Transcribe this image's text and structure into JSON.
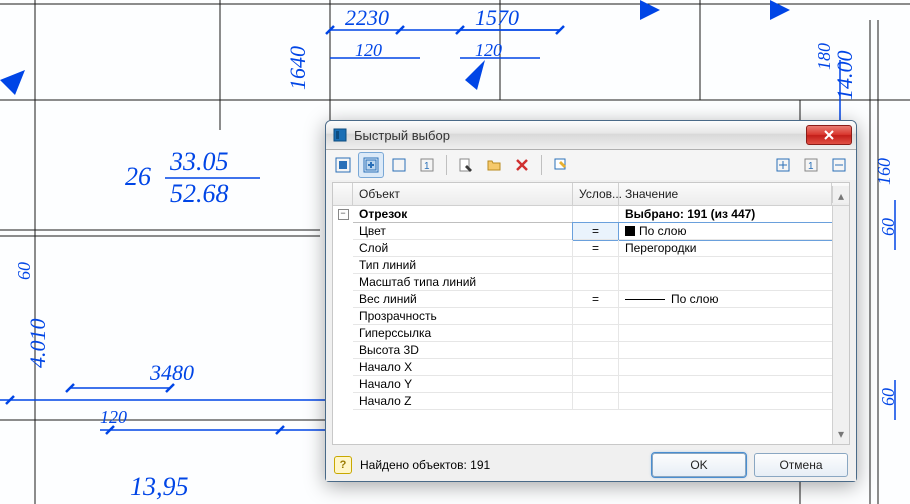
{
  "drawing": {
    "dims": {
      "d2230": "2230",
      "d1570": "1570",
      "d120a": "120",
      "d120b": "120",
      "d1640": "1640",
      "d180": "180",
      "d1400": "14.00",
      "d26": "26",
      "d3305": "33.05",
      "d5268": "52.68",
      "d160": "160",
      "d60a": "60",
      "d60b": "60",
      "d60c": "60",
      "d4010": "4.010",
      "d3480": "3480",
      "d120c": "120",
      "d1395": "13,95"
    }
  },
  "dialog": {
    "title": "Быстрый выбор",
    "columns": {
      "object": "Объект",
      "condition": "Услов...",
      "value": "Значение"
    },
    "group": {
      "label": "Отрезок",
      "summary": "Выбрано: 191 (из 447)"
    },
    "rows": {
      "color": {
        "label": "Цвет",
        "cond": "=",
        "value": "По слою"
      },
      "layer": {
        "label": "Слой",
        "cond": "=",
        "value": "Перегородки"
      },
      "ltype": {
        "label": "Тип линий",
        "cond": "",
        "value": ""
      },
      "lscale": {
        "label": "Масштаб типа линий",
        "cond": "",
        "value": ""
      },
      "lweight": {
        "label": "Вес линий",
        "cond": "=",
        "value": "По слою"
      },
      "transp": {
        "label": "Прозрачность",
        "cond": "",
        "value": ""
      },
      "hyper": {
        "label": "Гиперссылка",
        "cond": "",
        "value": ""
      },
      "h3d": {
        "label": "Высота 3D",
        "cond": "",
        "value": ""
      },
      "startx": {
        "label": "Начало X",
        "cond": "",
        "value": ""
      },
      "starty": {
        "label": "Начало Y",
        "cond": "",
        "value": ""
      },
      "startz": {
        "label": "Начало Z",
        "cond": "",
        "value": ""
      }
    },
    "status": "Найдено объектов: 191",
    "buttons": {
      "ok": "OK",
      "cancel": "Отмена"
    }
  },
  "chart_data": {
    "type": "table",
    "title": "Быстрый выбор — Отрезок (Выбрано: 191 из 447)",
    "columns": [
      "Объект",
      "Услов...",
      "Значение"
    ],
    "rows": [
      [
        "Цвет",
        "=",
        "По слою"
      ],
      [
        "Слой",
        "=",
        "Перегородки"
      ],
      [
        "Тип линий",
        "",
        ""
      ],
      [
        "Масштаб типа линий",
        "",
        ""
      ],
      [
        "Вес линий",
        "=",
        "По слою"
      ],
      [
        "Прозрачность",
        "",
        ""
      ],
      [
        "Гиперссылка",
        "",
        ""
      ],
      [
        "Высота 3D",
        "",
        ""
      ],
      [
        "Начало X",
        "",
        ""
      ],
      [
        "Начало Y",
        "",
        ""
      ],
      [
        "Начало Z",
        "",
        ""
      ]
    ],
    "found": 191,
    "total": 447
  }
}
